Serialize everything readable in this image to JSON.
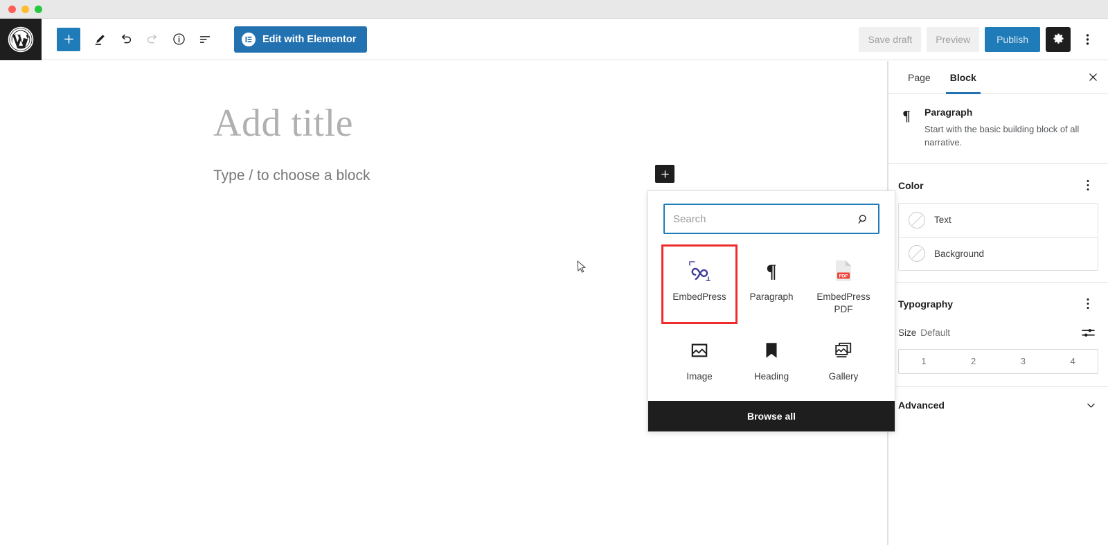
{
  "window": {
    "traffic_lights": [
      "close",
      "minimize",
      "maximize"
    ]
  },
  "toolbar": {
    "logo": "wordpress-logo",
    "add_block_label": "+",
    "tools": [
      {
        "name": "edit-pencil-icon",
        "label": "Tools"
      },
      {
        "name": "undo-icon",
        "label": "Undo"
      },
      {
        "name": "redo-icon",
        "label": "Redo"
      },
      {
        "name": "info-icon",
        "label": "Details"
      },
      {
        "name": "list-view-icon",
        "label": "List view"
      }
    ],
    "elementor_button": "Edit with Elementor",
    "elementor_mark": "E",
    "save_draft": "Save draft",
    "preview": "Preview",
    "publish": "Publish",
    "settings_icon": "gear-icon",
    "options_icon": "kebab-menu-icon"
  },
  "canvas": {
    "title_placeholder": "Add title",
    "paragraph_placeholder": "Type / to choose a block"
  },
  "inserter": {
    "plus_label": "+",
    "search": {
      "placeholder": "Search",
      "value": "",
      "icon": "search-icon"
    },
    "blocks": [
      {
        "label": "EmbedPress",
        "icon": "embedpress-icon",
        "highlighted": true
      },
      {
        "label": "Paragraph",
        "icon": "paragraph-pilcrow-icon",
        "highlighted": false
      },
      {
        "label": "EmbedPress PDF",
        "icon": "pdf-document-icon",
        "highlighted": false
      },
      {
        "label": "Image",
        "icon": "image-icon",
        "highlighted": false
      },
      {
        "label": "Heading",
        "icon": "heading-bookmark-icon",
        "highlighted": false
      },
      {
        "label": "Gallery",
        "icon": "gallery-icon",
        "highlighted": false
      }
    ],
    "browse_all": "Browse all",
    "highlight_color": "#ef2b2b"
  },
  "sidebar": {
    "tabs": [
      {
        "label": "Page",
        "active": false
      },
      {
        "label": "Block",
        "active": true
      }
    ],
    "close_icon": "close-icon",
    "block_info": {
      "icon": "paragraph-pilcrow-icon",
      "title": "Paragraph",
      "description": "Start with the basic building block of all narrative."
    },
    "color_section": {
      "title": "Color",
      "more_icon": "kebab-menu-icon",
      "rows": [
        {
          "label": "Text",
          "swatch": "none"
        },
        {
          "label": "Background",
          "swatch": "none"
        }
      ]
    },
    "typography_section": {
      "title": "Typography",
      "more_icon": "kebab-menu-icon",
      "size_label": "Size",
      "size_value": "Default",
      "size_control_icon": "sliders-icon",
      "size_options": [
        "1",
        "2",
        "3",
        "4"
      ]
    },
    "advanced_section": {
      "title": "Advanced",
      "chevron_icon": "chevron-down-icon"
    }
  },
  "colors": {
    "accent_blue": "#2271b1",
    "publish_blue": "#1f7cb8",
    "dark": "#1e1e1e",
    "highlight_red": "#ef2b2b",
    "embedpress_purple": "#3f3d97",
    "pdf_red": "#ef4136"
  }
}
